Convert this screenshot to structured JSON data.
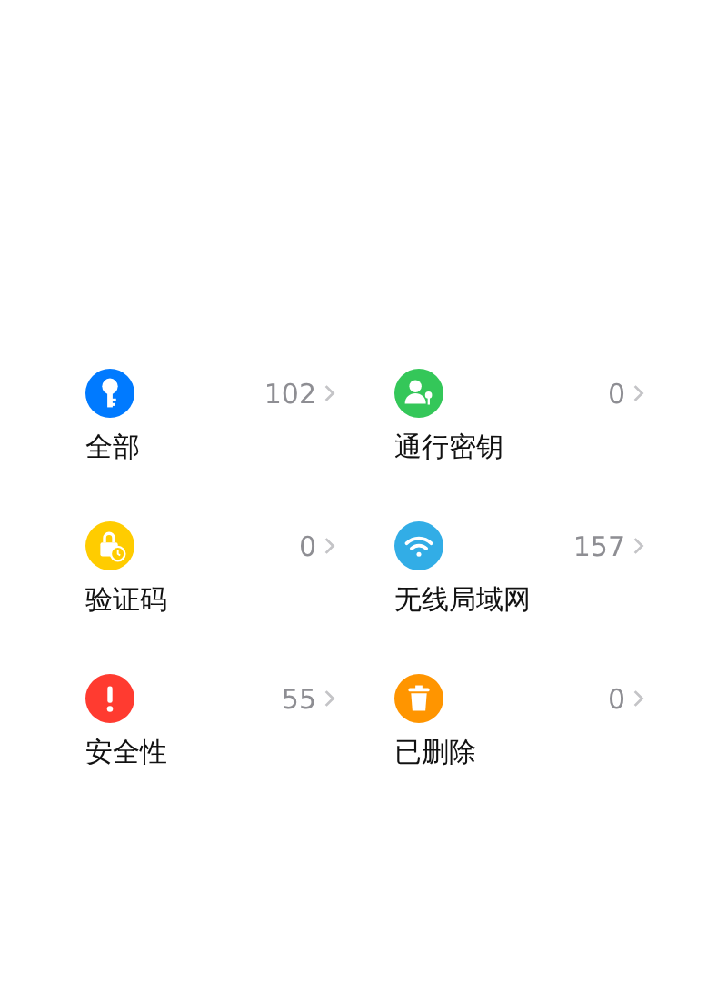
{
  "categories": [
    {
      "kind": "key",
      "color": "#007aff",
      "count": "102",
      "label": "全部"
    },
    {
      "kind": "passkey",
      "color": "#34c759",
      "count": "0",
      "label": "通行密钥"
    },
    {
      "kind": "code",
      "color": "#ffcc00",
      "count": "0",
      "label": "验证码"
    },
    {
      "kind": "wifi",
      "color": "#32ade6",
      "count": "157",
      "label": "无线局域网"
    },
    {
      "kind": "security",
      "color": "#ff3b30",
      "count": "55",
      "label": "安全性"
    },
    {
      "kind": "deleted",
      "color": "#ff9500",
      "count": "0",
      "label": "已删除"
    }
  ]
}
